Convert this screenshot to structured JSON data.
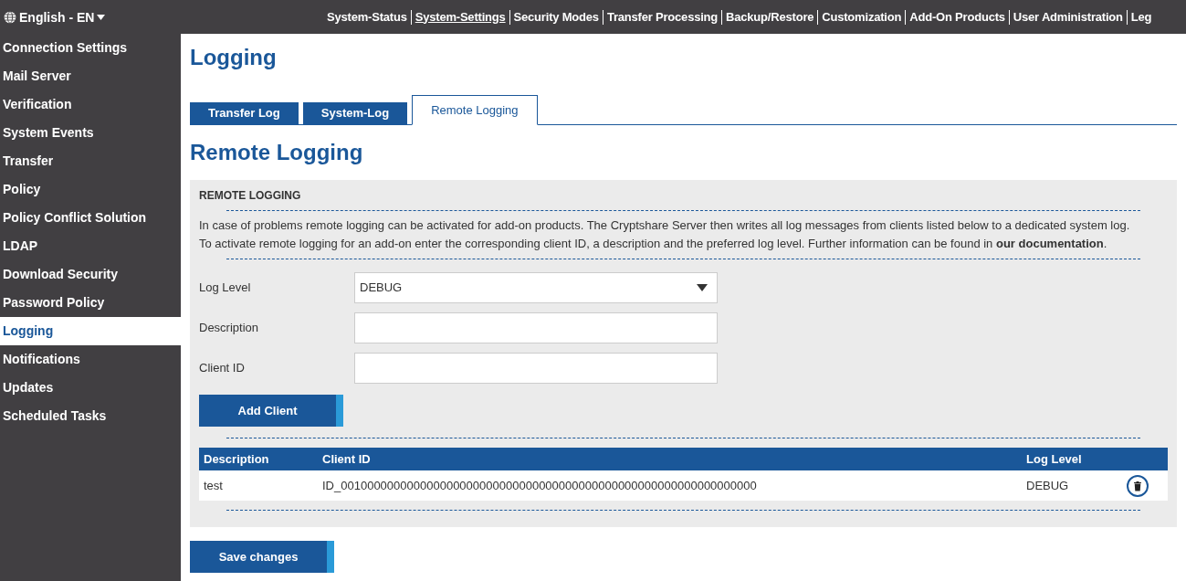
{
  "language": {
    "label": "English - EN"
  },
  "top_nav": [
    {
      "label": "System-Status",
      "selected": false
    },
    {
      "label": "System-Settings",
      "selected": true
    },
    {
      "label": "Security Modes",
      "selected": false
    },
    {
      "label": "Transfer Processing",
      "selected": false
    },
    {
      "label": "Backup/Restore",
      "selected": false
    },
    {
      "label": "Customization",
      "selected": false
    },
    {
      "label": "Add-On Products",
      "selected": false
    },
    {
      "label": "User Administration",
      "selected": false
    },
    {
      "label": "Leg",
      "selected": false
    }
  ],
  "sidebar": {
    "items": [
      {
        "label": "Connection Settings",
        "selected": false
      },
      {
        "label": "Mail Server",
        "selected": false
      },
      {
        "label": "Verification",
        "selected": false
      },
      {
        "label": "System Events",
        "selected": false
      },
      {
        "label": "Transfer",
        "selected": false
      },
      {
        "label": "Policy",
        "selected": false
      },
      {
        "label": "Policy Conflict Solution",
        "selected": false
      },
      {
        "label": "LDAP",
        "selected": false
      },
      {
        "label": "Download Security",
        "selected": false
      },
      {
        "label": "Password Policy",
        "selected": false
      },
      {
        "label": "Logging",
        "selected": true
      },
      {
        "label": "Notifications",
        "selected": false
      },
      {
        "label": "Updates",
        "selected": false
      },
      {
        "label": "Scheduled Tasks",
        "selected": false
      }
    ]
  },
  "page_title": "Logging",
  "tabs": [
    {
      "label": "Transfer Log",
      "selected": false
    },
    {
      "label": "System-Log",
      "selected": false
    },
    {
      "label": "Remote Logging",
      "selected": true
    }
  ],
  "section_title": "Remote Logging",
  "panel": {
    "heading": "REMOTE LOGGING",
    "intro": [
      "In case of problems remote logging can be activated for add-on products. The Cryptshare Server then writes all log messages from clients listed below to a dedicated system log.",
      "To activate remote logging for an add-on enter the corresponding client ID, a description and the preferred log level. Further information can be found in "
    ],
    "intro_link": "our documentation",
    "intro_end": ".",
    "fields": [
      {
        "kind": "select",
        "label": "Log Level",
        "value": "DEBUG"
      },
      {
        "kind": "text",
        "label": "Description"
      },
      {
        "kind": "text",
        "label": "Client ID"
      }
    ],
    "add_button": "Add Client",
    "table": {
      "columns": [
        "Description",
        "Client ID",
        "Log Level"
      ],
      "rows": [
        [
          "test",
          "ID_001000000000000000000000000000000000000000000000000000000000000",
          "DEBUG"
        ]
      ]
    }
  },
  "save_button": "Save changes"
}
